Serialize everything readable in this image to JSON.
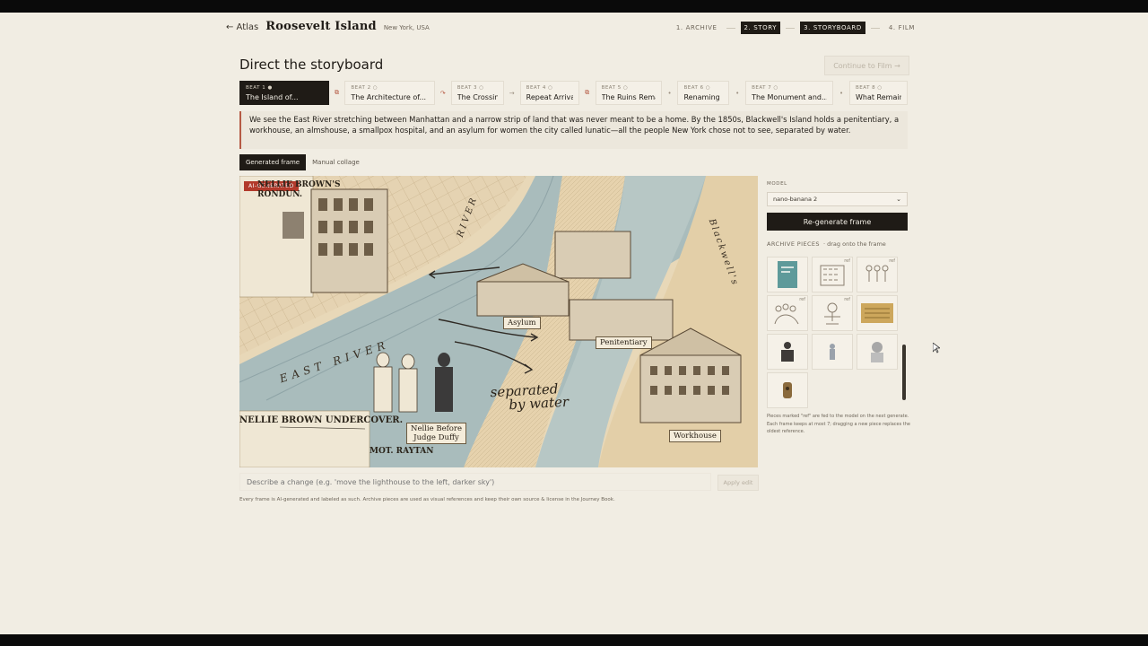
{
  "header": {
    "back_label": "← Atlas",
    "project_title": "Roosevelt Island",
    "location": "New York, USA",
    "steps": [
      {
        "label": "1. ARCHIVE",
        "active": false
      },
      {
        "label": "2. STORY",
        "active": true
      },
      {
        "label": "3. STORYBOARD",
        "active": true
      },
      {
        "label": "4. FILM",
        "active": false
      }
    ]
  },
  "page": {
    "title": "Direct the storyboard",
    "continue_label": "Continue to Film →"
  },
  "beats": [
    {
      "num": "BEAT 1 ●",
      "title": "The Island of...",
      "active": true
    },
    {
      "num": "BEAT 2 ○",
      "title": "The Architecture of...",
      "active": false
    },
    {
      "num": "BEAT 3 ○",
      "title": "The Crossing",
      "active": false
    },
    {
      "num": "BEAT 4 ○",
      "title": "Repeat Arrivals",
      "active": false
    },
    {
      "num": "BEAT 5 ○",
      "title": "The Ruins Remain",
      "active": false
    },
    {
      "num": "BEAT 6 ○",
      "title": "Renaming",
      "active": false
    },
    {
      "num": "BEAT 7 ○",
      "title": "The Monument and...",
      "active": false
    },
    {
      "num": "BEAT 8 ○",
      "title": "What Remains",
      "active": false
    }
  ],
  "narration": "We see the East River stretching between Manhattan and a narrow strip of land that was never meant to be a home. By the 1850s, Blackwell's Island holds a penitentiary, a workhouse, an almshouse, a smallpox hospital, and an asylum for women the city called lunatic—all the people New York chose not to see, separated by water.",
  "tabs": [
    {
      "label": "Generated frame",
      "active": true
    },
    {
      "label": "Manual collage",
      "active": false
    }
  ],
  "frame": {
    "badge": "AI-GENERATED",
    "labels": {
      "asylum": "Asylum",
      "penitentiary": "Penitentiary",
      "workhouse": "Workhouse",
      "nellie_line1": "Nellie Before",
      "nellie_line2": "Judge Duffy",
      "separated_line1": "separated",
      "separated_line2": "by water",
      "east_river": "EAST RIVER",
      "river_vertical": "RIVER",
      "blackwell": "Blackwell's",
      "headline": "NELLIE BROWN UNDERCOVER.",
      "headline_top": "NELLIE BROWN'S",
      "headline_top2": "RONDUN.",
      "sub_headline": "MOT. RAYTAN"
    }
  },
  "edit": {
    "placeholder": "Describe a change (e.g. 'move the lighthouse to the left, darker sky')",
    "apply_label": "Apply edit"
  },
  "footnote": "Every frame is AI-generated and labeled as such. Archive pieces are used as visual references and keep their own source & license in the Journey Book.",
  "side": {
    "model_label": "MODEL",
    "model_value": "nano-banana 2",
    "regen_label": "Re-generate frame",
    "pieces_label": "ARCHIVE PIECES",
    "pieces_hint": "· drag onto the frame",
    "ref_label": "ref",
    "note": "Pieces marked \"ref\" are fed to the model on the next generate. Each frame keeps at most 7; dragging a new piece replaces the oldest reference."
  },
  "colors": {
    "accent": "#b55a44",
    "dark": "#1f1b16",
    "background": "#f1ede3",
    "badge": "#b23a2b"
  }
}
